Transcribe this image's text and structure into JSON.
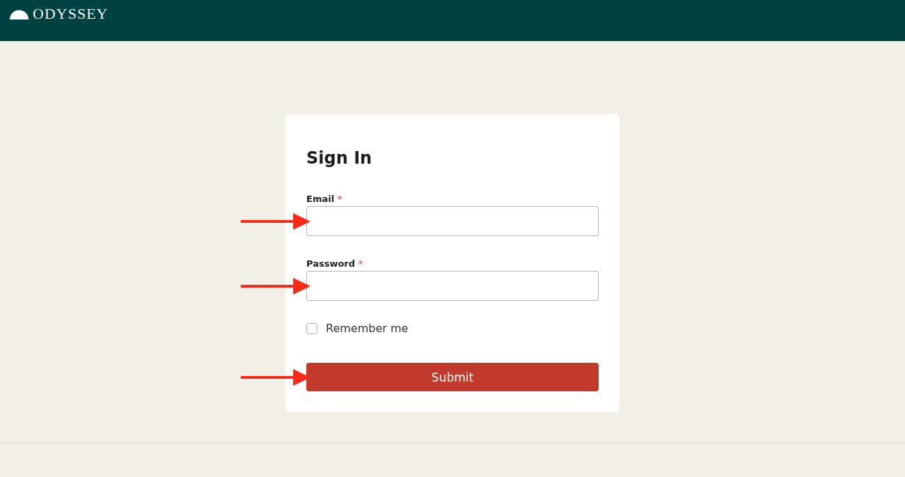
{
  "header": {
    "logo_text": "ODYSSEY"
  },
  "form": {
    "title": "Sign In",
    "fields": [
      {
        "label": "Email",
        "required_mark": "*",
        "arrow": true
      },
      {
        "label": "Password",
        "required_mark": "*",
        "arrow": true
      }
    ],
    "remember": {
      "label": "Remember me",
      "checked": false
    },
    "submit": {
      "label": "Submit",
      "arrow": true
    }
  }
}
